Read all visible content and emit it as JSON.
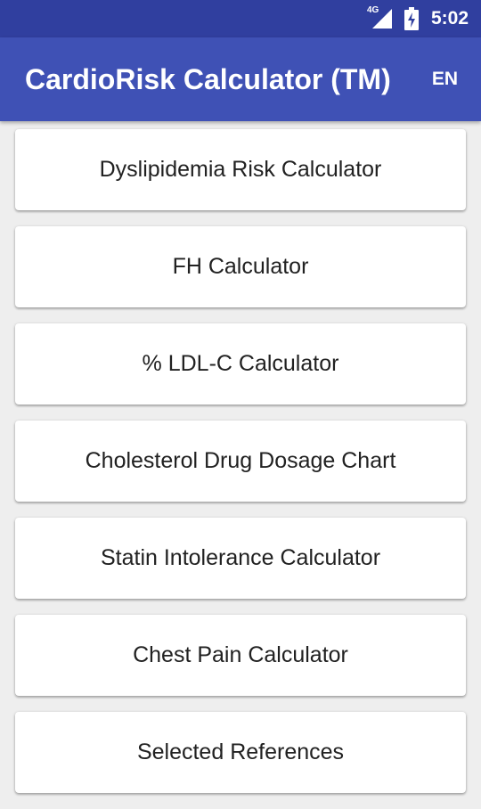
{
  "status_bar": {
    "network_type": "4G",
    "time": "5:02",
    "icons": [
      "signal-icon",
      "battery-charging-icon"
    ]
  },
  "app_bar": {
    "title": "CardioRisk Calculator (TM)",
    "language": "EN"
  },
  "menu": {
    "items": [
      {
        "label": "Dyslipidemia Risk Calculator"
      },
      {
        "label": "FH Calculator"
      },
      {
        "label": "% LDL-C Calculator"
      },
      {
        "label": "Cholesterol Drug Dosage Chart"
      },
      {
        "label": "Statin Intolerance Calculator"
      },
      {
        "label": "Chest Pain Calculator"
      },
      {
        "label": "Selected References"
      }
    ]
  },
  "colors": {
    "status_bar": "#303f9f",
    "app_bar": "#3f51b5",
    "background": "#eeeeee",
    "card": "#ffffff",
    "card_text": "#212121"
  }
}
